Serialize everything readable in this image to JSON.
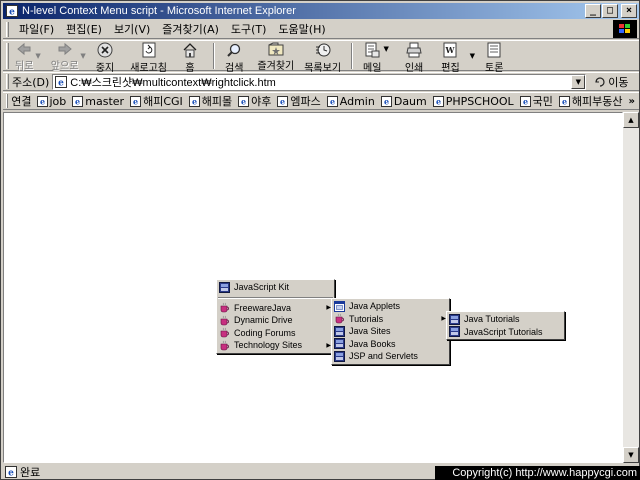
{
  "window": {
    "title": "N-level Context Menu script - Microsoft Internet Explorer",
    "minimize": "_",
    "maximize": "□",
    "close": "×"
  },
  "menubar": {
    "items": [
      "파일(F)",
      "편집(E)",
      "보기(V)",
      "즐겨찾기(A)",
      "도구(T)",
      "도움말(H)"
    ]
  },
  "toolbar": {
    "back": "뒤로",
    "forward": "앞으로",
    "stop": "중지",
    "refresh": "새로고침",
    "home": "홈",
    "search": "검색",
    "favorites": "즐겨찾기",
    "history": "목록보기",
    "mail": "메일",
    "print": "인쇄",
    "edit": "편집",
    "discuss": "토론"
  },
  "address": {
    "label": "주소(D)",
    "value": "C:₩스크린샷₩multicontext₩rightclick.htm",
    "go": "이동"
  },
  "links": {
    "label": "연결",
    "items": [
      "job",
      "master",
      "해피CGI",
      "해피몰",
      "야후",
      "엠파스",
      "Admin",
      "Daum",
      "PHPSCHOOL",
      "국민",
      "해피부동산"
    ],
    "more": "»"
  },
  "context_menu": {
    "root": {
      "top": "JavaScript Kit",
      "items": [
        "FreewareJava",
        "Dynamic Drive",
        "Coding Forums",
        "Technology Sites"
      ]
    },
    "freewarejava": [
      "Java Applets",
      "Tutorials",
      "Java Sites",
      "Java Books",
      "JSP and Servlets"
    ],
    "tutorials": [
      "Java Tutorials",
      "JavaScript Tutorials"
    ]
  },
  "status": {
    "text": "완료"
  },
  "copyright": "Copyright(c) http://www.happycgi.com",
  "colors": {
    "title_start": "#0a246a",
    "title_end": "#a6caf0",
    "chrome": "#d4d0c8"
  }
}
